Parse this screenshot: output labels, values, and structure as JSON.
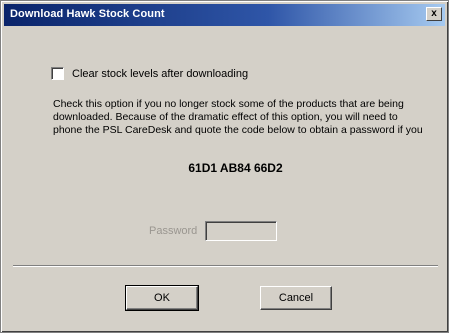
{
  "window": {
    "title": "Download Hawk Stock Count",
    "close_label": "x"
  },
  "options": {
    "clear_stock_label": "Clear stock levels after downloading",
    "clear_stock_checked": false,
    "description": "Check this option if you no longer stock some of the products that are being downloaded. Because of the dramatic effect of this option, you will need to phone the PSL CareDesk and quote the code below to obtain a password if you",
    "code": "61D1 AB84 66D2"
  },
  "password": {
    "label": "Password",
    "value": ""
  },
  "buttons": {
    "ok_label": "OK",
    "cancel_label": "Cancel"
  }
}
